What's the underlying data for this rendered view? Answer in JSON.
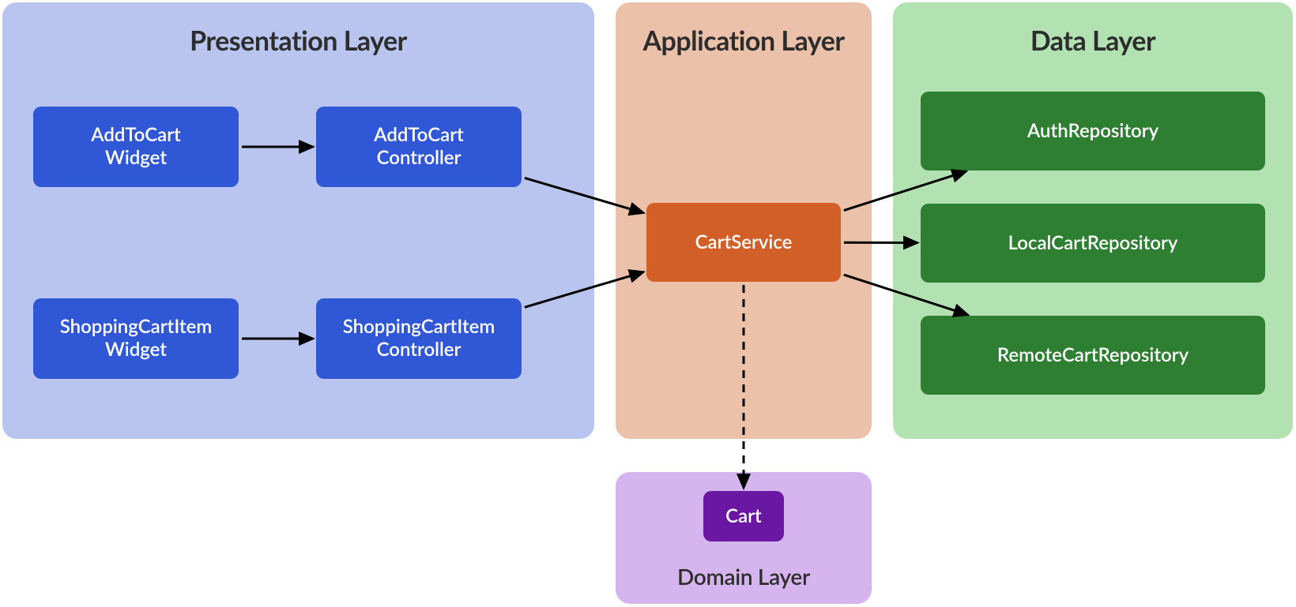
{
  "layers": {
    "presentation": {
      "title": "Presentation Layer",
      "bg": "#b9c5ef"
    },
    "application": {
      "title": "Application Layer",
      "bg": "#ecc1aa"
    },
    "data": {
      "title": "Data Layer",
      "bg": "#b2e2b2"
    },
    "domain": {
      "title": "Domain Layer",
      "bg": "#d6b4ee"
    }
  },
  "nodes": {
    "addToCartWidget": {
      "label_l1": "AddToCart",
      "label_l2": "Widget",
      "bg": "#3057d5"
    },
    "addToCartController": {
      "label_l1": "AddToCart",
      "label_l2": "Controller",
      "bg": "#3057d5"
    },
    "shoppingCartItemWidget": {
      "label_l1": "ShoppingCartItem",
      "label_l2": "Widget",
      "bg": "#3057d5"
    },
    "shoppingCartItemCtrl": {
      "label_l1": "ShoppingCartItem",
      "label_l2": "Controller",
      "bg": "#3057d5"
    },
    "cartService": {
      "label": "CartService",
      "bg": "#d25f27"
    },
    "authRepository": {
      "label": "AuthRepository",
      "bg": "#2f7f33"
    },
    "localCartRepository": {
      "label": "LocalCartRepository",
      "bg": "#2f7f33"
    },
    "remoteCartRepository": {
      "label": "RemoteCartRepository",
      "bg": "#2f7f33"
    },
    "cart": {
      "label": "Cart",
      "bg": "#6a17a3"
    }
  },
  "arrows": [
    {
      "from": "addToCartWidget",
      "to": "addToCartController",
      "dashed": false
    },
    {
      "from": "shoppingCartItemWidget",
      "to": "shoppingCartItemCtrl",
      "dashed": false
    },
    {
      "from": "addToCartController",
      "to": "cartService",
      "dashed": false
    },
    {
      "from": "shoppingCartItemCtrl",
      "to": "cartService",
      "dashed": false
    },
    {
      "from": "cartService",
      "to": "authRepository",
      "dashed": false
    },
    {
      "from": "cartService",
      "to": "localCartRepository",
      "dashed": false
    },
    {
      "from": "cartService",
      "to": "remoteCartRepository",
      "dashed": false
    },
    {
      "from": "cartService",
      "to": "cart",
      "dashed": true
    }
  ]
}
